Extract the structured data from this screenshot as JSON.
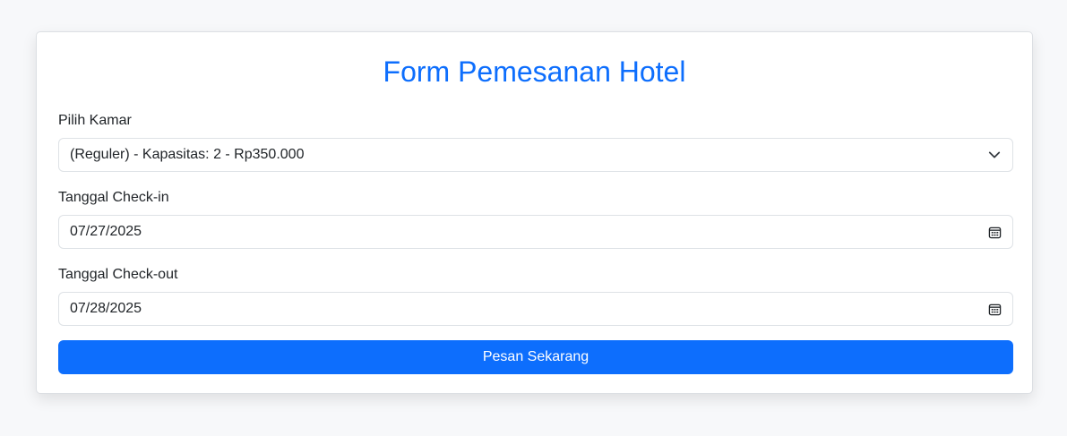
{
  "form": {
    "title": "Form Pemesanan Hotel",
    "room": {
      "label": "Pilih Kamar",
      "selected": "(Reguler) - Kapasitas: 2 - Rp350.000"
    },
    "checkin": {
      "label": "Tanggal Check-in",
      "value": "07/27/2025"
    },
    "checkout": {
      "label": "Tanggal Check-out",
      "value": "07/28/2025"
    },
    "submit_label": "Pesan Sekarang"
  },
  "colors": {
    "accent": "#0d6efd",
    "background": "#f7f8fa"
  },
  "icons": {
    "select": "chevron-down-icon",
    "date": "calendar-icon"
  }
}
